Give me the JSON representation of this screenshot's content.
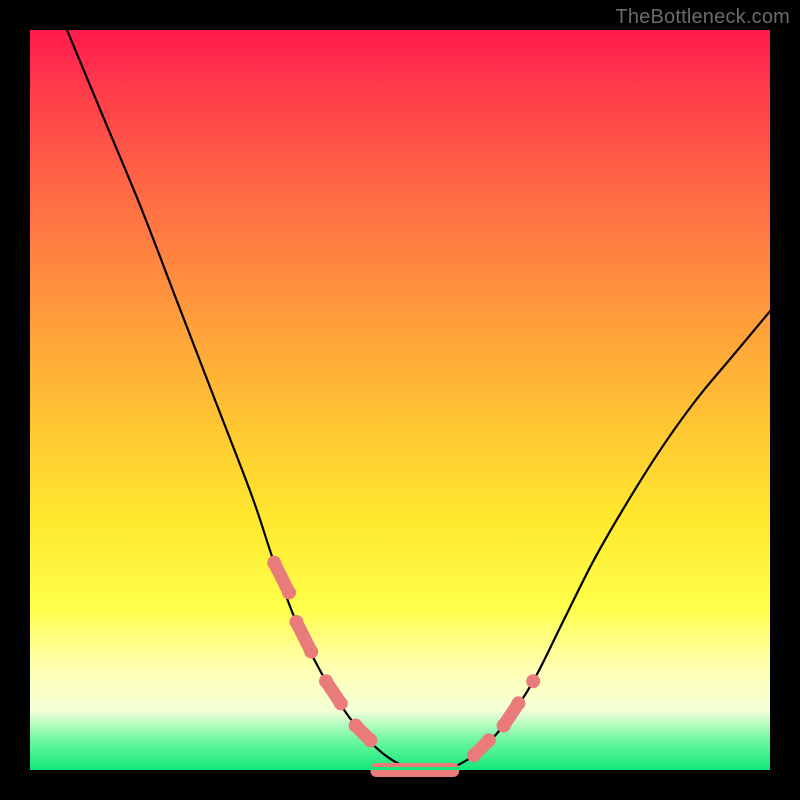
{
  "watermark": "TheBottleneck.com",
  "chart_data": {
    "type": "line",
    "title": "",
    "xlabel": "",
    "ylabel": "",
    "xlim": [
      0,
      100
    ],
    "ylim": [
      0,
      100
    ],
    "grid": false,
    "series": [
      {
        "name": "bottleneck-curve",
        "x": [
          5,
          10,
          15,
          20,
          25,
          30,
          33,
          36,
          40,
          44,
          48,
          52,
          56,
          60,
          64,
          68,
          72,
          76,
          80,
          85,
          90,
          95,
          100
        ],
        "values": [
          100,
          88,
          76,
          63,
          50,
          37,
          28,
          20,
          12,
          6,
          2,
          0,
          0,
          2,
          6,
          12,
          20,
          28,
          35,
          43,
          50,
          56,
          62
        ]
      }
    ],
    "markers_left": {
      "name": "left-segment-markers",
      "x": [
        33,
        35,
        36,
        38,
        40,
        42,
        44,
        46
      ],
      "values": [
        28,
        24,
        20,
        16,
        12,
        9,
        6,
        4
      ]
    },
    "markers_right": {
      "name": "right-segment-markers",
      "x": [
        60,
        62,
        64,
        66,
        68
      ],
      "values": [
        2,
        4,
        6,
        9,
        12
      ]
    },
    "flat_bottom": {
      "name": "bottom-pill",
      "x_start": 46,
      "x_end": 58,
      "value": 0
    },
    "background_gradient": {
      "top": "#ff1a4d",
      "mid_upper": "#ff9a3c",
      "mid": "#ffe82e",
      "mid_lower": "#ffffb0",
      "bottom": "#14e77b"
    }
  }
}
